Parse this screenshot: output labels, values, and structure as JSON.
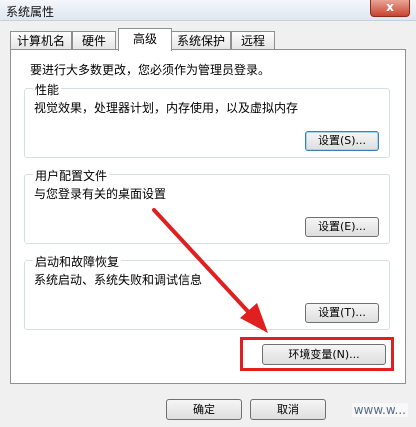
{
  "window": {
    "title": "系统属性",
    "close_label": "x"
  },
  "tabs": [
    {
      "label": "计算机名",
      "active": false
    },
    {
      "label": "硬件",
      "active": false
    },
    {
      "label": "高级",
      "active": true
    },
    {
      "label": "系统保护",
      "active": false
    },
    {
      "label": "远程",
      "active": false
    }
  ],
  "intro_text": "要进行大多数更改，您必须作为管理员登录。",
  "groups": {
    "performance": {
      "title": "性能",
      "description": "视觉效果，处理器计划，内存使用，以及虚拟内存",
      "button": "设置(S)..."
    },
    "user_profiles": {
      "title": "用户配置文件",
      "description": "与您登录有关的桌面设置",
      "button": "设置(E)..."
    },
    "startup_recovery": {
      "title": "启动和故障恢复",
      "description": "系统启动、系统失败和调试信息",
      "button": "设置(T)..."
    }
  },
  "env_button": "环境变量(N)...",
  "footer": {
    "ok": "确定",
    "cancel": "取消"
  },
  "watermark": "www.w...",
  "colors": {
    "annotation": "#e02020",
    "panel_border": "#8e8f8f"
  }
}
